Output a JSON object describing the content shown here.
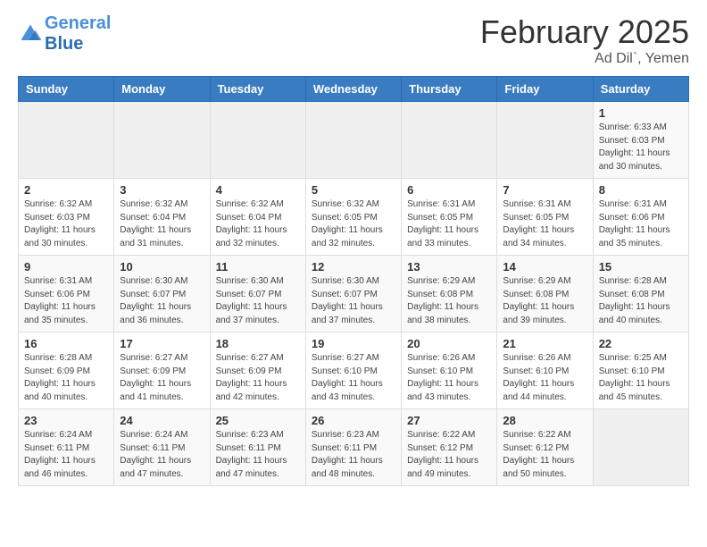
{
  "header": {
    "logo_line1": "General",
    "logo_line2": "Blue",
    "title": "February 2025",
    "subtitle": "Ad Dil`, Yemen"
  },
  "days_of_week": [
    "Sunday",
    "Monday",
    "Tuesday",
    "Wednesday",
    "Thursday",
    "Friday",
    "Saturday"
  ],
  "weeks": [
    [
      {
        "day": "",
        "info": ""
      },
      {
        "day": "",
        "info": ""
      },
      {
        "day": "",
        "info": ""
      },
      {
        "day": "",
        "info": ""
      },
      {
        "day": "",
        "info": ""
      },
      {
        "day": "",
        "info": ""
      },
      {
        "day": "1",
        "info": "Sunrise: 6:33 AM\nSunset: 6:03 PM\nDaylight: 11 hours and 30 minutes."
      }
    ],
    [
      {
        "day": "2",
        "info": "Sunrise: 6:32 AM\nSunset: 6:03 PM\nDaylight: 11 hours and 30 minutes."
      },
      {
        "day": "3",
        "info": "Sunrise: 6:32 AM\nSunset: 6:04 PM\nDaylight: 11 hours and 31 minutes."
      },
      {
        "day": "4",
        "info": "Sunrise: 6:32 AM\nSunset: 6:04 PM\nDaylight: 11 hours and 32 minutes."
      },
      {
        "day": "5",
        "info": "Sunrise: 6:32 AM\nSunset: 6:05 PM\nDaylight: 11 hours and 32 minutes."
      },
      {
        "day": "6",
        "info": "Sunrise: 6:31 AM\nSunset: 6:05 PM\nDaylight: 11 hours and 33 minutes."
      },
      {
        "day": "7",
        "info": "Sunrise: 6:31 AM\nSunset: 6:05 PM\nDaylight: 11 hours and 34 minutes."
      },
      {
        "day": "8",
        "info": "Sunrise: 6:31 AM\nSunset: 6:06 PM\nDaylight: 11 hours and 35 minutes."
      }
    ],
    [
      {
        "day": "9",
        "info": "Sunrise: 6:31 AM\nSunset: 6:06 PM\nDaylight: 11 hours and 35 minutes."
      },
      {
        "day": "10",
        "info": "Sunrise: 6:30 AM\nSunset: 6:07 PM\nDaylight: 11 hours and 36 minutes."
      },
      {
        "day": "11",
        "info": "Sunrise: 6:30 AM\nSunset: 6:07 PM\nDaylight: 11 hours and 37 minutes."
      },
      {
        "day": "12",
        "info": "Sunrise: 6:30 AM\nSunset: 6:07 PM\nDaylight: 11 hours and 37 minutes."
      },
      {
        "day": "13",
        "info": "Sunrise: 6:29 AM\nSunset: 6:08 PM\nDaylight: 11 hours and 38 minutes."
      },
      {
        "day": "14",
        "info": "Sunrise: 6:29 AM\nSunset: 6:08 PM\nDaylight: 11 hours and 39 minutes."
      },
      {
        "day": "15",
        "info": "Sunrise: 6:28 AM\nSunset: 6:08 PM\nDaylight: 11 hours and 40 minutes."
      }
    ],
    [
      {
        "day": "16",
        "info": "Sunrise: 6:28 AM\nSunset: 6:09 PM\nDaylight: 11 hours and 40 minutes."
      },
      {
        "day": "17",
        "info": "Sunrise: 6:27 AM\nSunset: 6:09 PM\nDaylight: 11 hours and 41 minutes."
      },
      {
        "day": "18",
        "info": "Sunrise: 6:27 AM\nSunset: 6:09 PM\nDaylight: 11 hours and 42 minutes."
      },
      {
        "day": "19",
        "info": "Sunrise: 6:27 AM\nSunset: 6:10 PM\nDaylight: 11 hours and 43 minutes."
      },
      {
        "day": "20",
        "info": "Sunrise: 6:26 AM\nSunset: 6:10 PM\nDaylight: 11 hours and 43 minutes."
      },
      {
        "day": "21",
        "info": "Sunrise: 6:26 AM\nSunset: 6:10 PM\nDaylight: 11 hours and 44 minutes."
      },
      {
        "day": "22",
        "info": "Sunrise: 6:25 AM\nSunset: 6:10 PM\nDaylight: 11 hours and 45 minutes."
      }
    ],
    [
      {
        "day": "23",
        "info": "Sunrise: 6:24 AM\nSunset: 6:11 PM\nDaylight: 11 hours and 46 minutes."
      },
      {
        "day": "24",
        "info": "Sunrise: 6:24 AM\nSunset: 6:11 PM\nDaylight: 11 hours and 47 minutes."
      },
      {
        "day": "25",
        "info": "Sunrise: 6:23 AM\nSunset: 6:11 PM\nDaylight: 11 hours and 47 minutes."
      },
      {
        "day": "26",
        "info": "Sunrise: 6:23 AM\nSunset: 6:11 PM\nDaylight: 11 hours and 48 minutes."
      },
      {
        "day": "27",
        "info": "Sunrise: 6:22 AM\nSunset: 6:12 PM\nDaylight: 11 hours and 49 minutes."
      },
      {
        "day": "28",
        "info": "Sunrise: 6:22 AM\nSunset: 6:12 PM\nDaylight: 11 hours and 50 minutes."
      },
      {
        "day": "",
        "info": ""
      }
    ]
  ]
}
